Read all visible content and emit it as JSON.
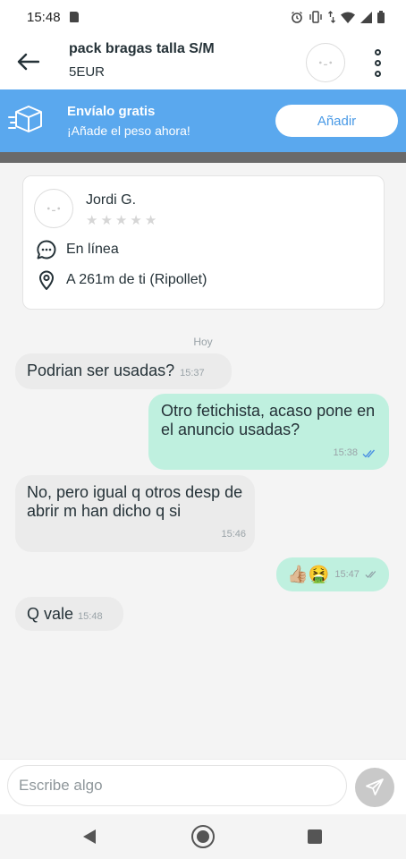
{
  "status_bar": {
    "time": "15:48",
    "icons": [
      "sd-card-icon",
      "alarm-icon",
      "vibrate-icon",
      "data-arrows-icon",
      "wifi-icon",
      "signal-icon",
      "battery-icon"
    ]
  },
  "header": {
    "title": "pack bragas talla S/M",
    "price": "5EUR",
    "icons": [
      "back-arrow-icon",
      "avatar",
      "more-options-icon"
    ]
  },
  "banner": {
    "title": "Envíalo gratis",
    "subtitle": "¡Añade el peso ahora!",
    "button_label": "Añadir",
    "color": "#5aa8ee",
    "icon": "box-icon"
  },
  "user_card": {
    "name": "Jordi G.",
    "rating": 0,
    "rating_max": 5,
    "status": "En línea",
    "location": "A 261m de ti (Ripollet)",
    "icons": [
      "chat-bubble-icon",
      "location-pin-icon"
    ]
  },
  "chat": {
    "day_label": "Hoy",
    "messages": [
      {
        "direction": "in",
        "text": "Podrian ser usadas?",
        "time": "15:37"
      },
      {
        "direction": "out",
        "text": "Otro fetichista, acaso pone en el anuncio usadas?",
        "time": "15:38",
        "read": true
      },
      {
        "direction": "in",
        "text": "No, pero igual q otros desp de abrir m han dicho q si",
        "time": "15:46"
      },
      {
        "direction": "out",
        "text": "👍🏼🤮",
        "time": "15:47",
        "read": false
      },
      {
        "direction": "in",
        "text": "Q vale",
        "time": "15:48"
      }
    ],
    "colors": {
      "incoming": "#ebebeb",
      "outgoing": "#bff0df",
      "read_check": "#4a90e2"
    }
  },
  "input": {
    "placeholder": "Escribe algo",
    "send_icon": "send-icon"
  },
  "nav_bar": {
    "icons": [
      "nav-back-icon",
      "nav-home-icon",
      "nav-recents-icon"
    ]
  }
}
